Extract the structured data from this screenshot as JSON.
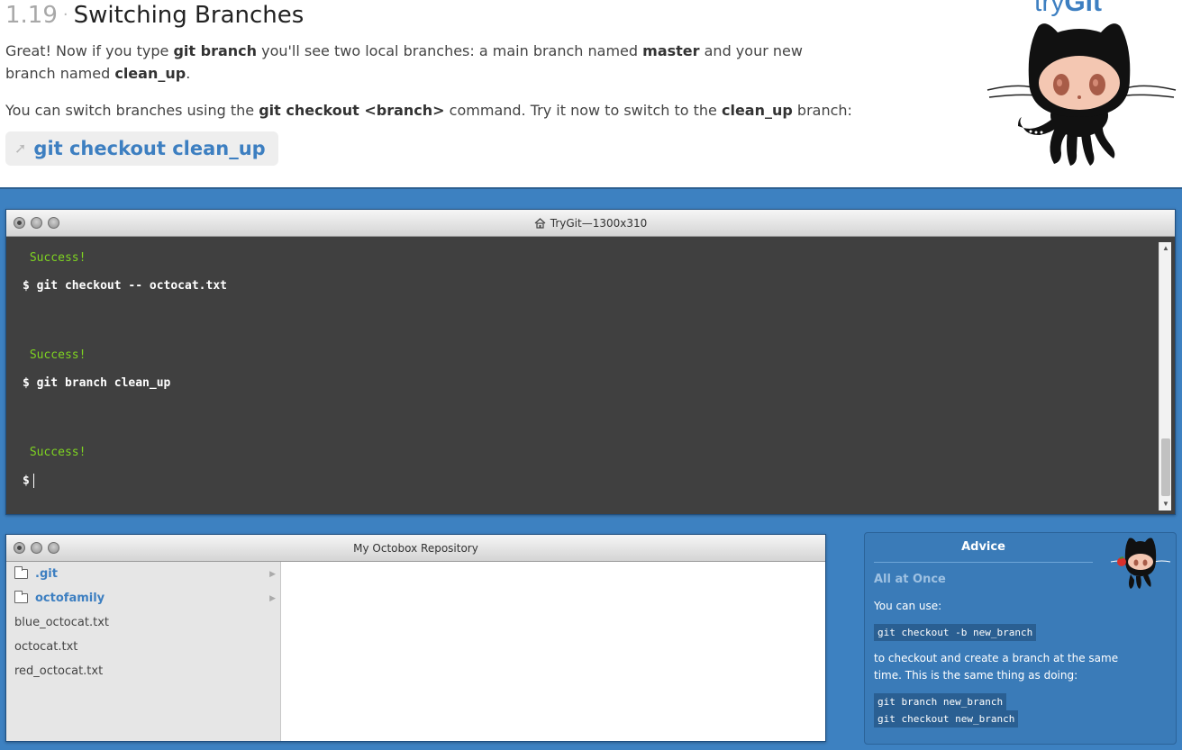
{
  "lesson": {
    "number": "1.19",
    "separator": "·",
    "title": "Switching Branches",
    "p1": {
      "t1": "Great! Now if you type ",
      "b1": "git branch",
      "t2": " you'll see two local branches: a main branch named ",
      "b2": "master",
      "t3": " and your new branch named ",
      "b3": "clean_up",
      "t4": "."
    },
    "p2": {
      "t1": "You can switch branches using the ",
      "b1": "git checkout <branch>",
      "t2": " command. Try it now to switch to the ",
      "b2": "clean_up",
      "t3": " branch:"
    },
    "hint_command": "git checkout clean_up",
    "hint_icon": "arrow-icon"
  },
  "logo": {
    "text_light": "try",
    "text_bold": "Git"
  },
  "terminal": {
    "title": "TryGit—1300x310",
    "title_icon": "home-icon",
    "lines": [
      {
        "kind": "success",
        "text": " Success!"
      },
      {
        "kind": "cmd",
        "text": "$ git checkout -- octocat.txt"
      },
      {
        "kind": "success",
        "text": " Success!"
      },
      {
        "kind": "cmd",
        "text": "$ git branch clean_up"
      },
      {
        "kind": "success",
        "text": " Success!"
      },
      {
        "kind": "cmd",
        "text": "$"
      }
    ]
  },
  "filebrowser": {
    "title": "My Octobox Repository",
    "items": [
      {
        "name": ".git",
        "type": "folder"
      },
      {
        "name": "octofamily",
        "type": "folder"
      },
      {
        "name": "blue_octocat.txt",
        "type": "file"
      },
      {
        "name": "octocat.txt",
        "type": "file"
      },
      {
        "name": "red_octocat.txt",
        "type": "file"
      }
    ]
  },
  "advice": {
    "heading": "Advice",
    "subheading": "All at Once",
    "line1": "You can use:",
    "code1": "git checkout -b new_branch",
    "line2": "to checkout and create a branch at the same time. This is the same thing as doing:",
    "code2a": "git branch new_branch",
    "code2b": "git checkout new_branch"
  },
  "colors": {
    "accent": "#3d7fc1",
    "workspace_bg": "#3d81c1",
    "terminal_bg": "#404040",
    "success": "#7ed321"
  }
}
